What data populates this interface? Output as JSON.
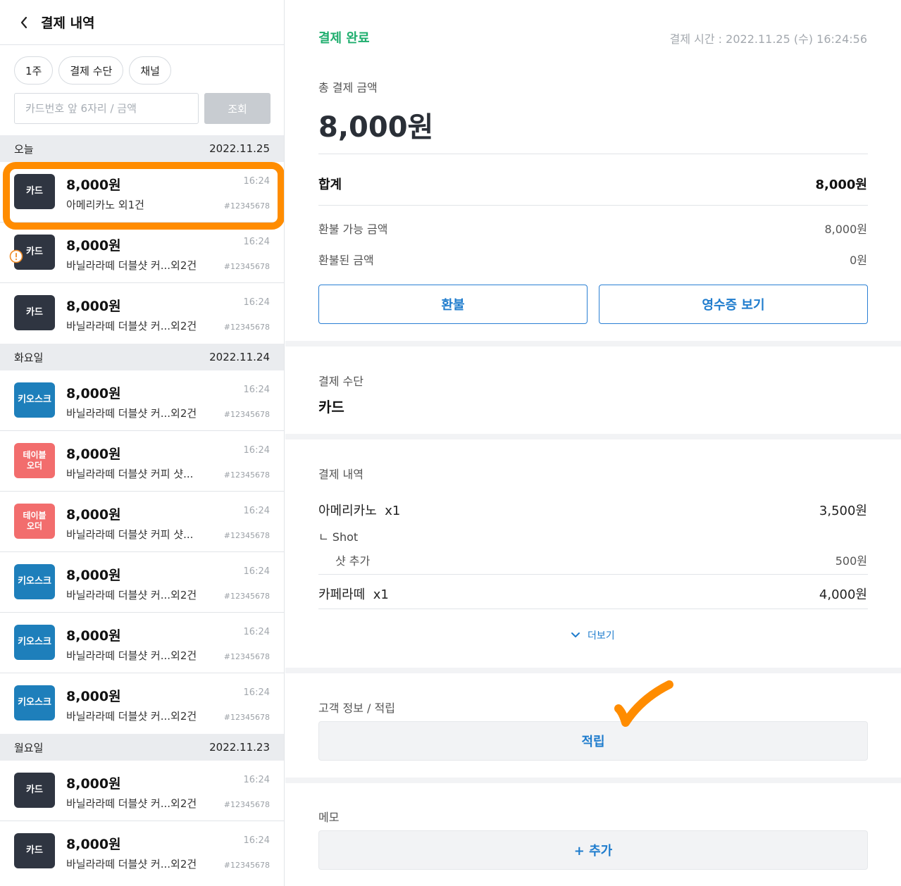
{
  "header": {
    "title": "결제 내역"
  },
  "filters": {
    "chips": [
      "1주",
      "결제 수단",
      "채널"
    ]
  },
  "search": {
    "placeholder": "카드번호 앞 6자리 / 금액",
    "button_label": "조회"
  },
  "colors": {
    "highlight": "#ff8c00",
    "accent_blue": "#1f7ccd",
    "status_green": "#1fae6e",
    "card_badge": "#2f3541",
    "kiosk_badge": "#1e7fbb",
    "table_badge": "#f26d6d"
  },
  "groups": [
    {
      "day": "오늘",
      "date": "2022.11.25",
      "items": [
        {
          "badge": "카드",
          "type": "card",
          "amount": "8,000원",
          "desc": "아메리카노 외1건",
          "time": "16:24",
          "order": "#12345678",
          "selected": true,
          "warning": false
        },
        {
          "badge": "카드",
          "type": "card",
          "amount": "8,000원",
          "desc": "바닐라라떼 더블샷 커...외2건",
          "time": "16:24",
          "order": "#12345678",
          "selected": false,
          "warning": true
        },
        {
          "badge": "카드",
          "type": "card",
          "amount": "8,000원",
          "desc": "바닐라라떼 더블샷 커...외2건",
          "time": "16:24",
          "order": "#12345678",
          "selected": false,
          "warning": false
        }
      ]
    },
    {
      "day": "화요일",
      "date": "2022.11.24",
      "items": [
        {
          "badge": "키오스크",
          "type": "kiosk",
          "amount": "8,000원",
          "desc": "바닐라라떼 더블샷 커...외2건",
          "time": "16:24",
          "order": "#12345678",
          "selected": false,
          "warning": false
        },
        {
          "badge": "테이블\n오더",
          "type": "table",
          "amount": "8,000원",
          "desc": "바닐라라떼 더블샷 커피 샷...",
          "time": "16:24",
          "order": "#12345678",
          "selected": false,
          "warning": false
        },
        {
          "badge": "테이블\n오더",
          "type": "table",
          "amount": "8,000원",
          "desc": "바닐라라떼 더블샷 커피 샷...",
          "time": "16:24",
          "order": "#12345678",
          "selected": false,
          "warning": false
        },
        {
          "badge": "키오스크",
          "type": "kiosk",
          "amount": "8,000원",
          "desc": "바닐라라떼 더블샷 커...외2건",
          "time": "16:24",
          "order": "#12345678",
          "selected": false,
          "warning": false
        },
        {
          "badge": "키오스크",
          "type": "kiosk",
          "amount": "8,000원",
          "desc": "바닐라라떼 더블샷 커...외2건",
          "time": "16:24",
          "order": "#12345678",
          "selected": false,
          "warning": false
        },
        {
          "badge": "키오스크",
          "type": "kiosk",
          "amount": "8,000원",
          "desc": "바닐라라떼 더블샷 커...외2건",
          "time": "16:24",
          "order": "#12345678",
          "selected": false,
          "warning": false
        }
      ]
    },
    {
      "day": "월요일",
      "date": "2022.11.23",
      "items": [
        {
          "badge": "카드",
          "type": "card",
          "amount": "8,000원",
          "desc": "바닐라라떼 더블샷 커...외2건",
          "time": "16:24",
          "order": "#12345678",
          "selected": false,
          "warning": false
        },
        {
          "badge": "카드",
          "type": "card",
          "amount": "8,000원",
          "desc": "바닐라라떼 더블샷 커...외2건",
          "time": "16:24",
          "order": "#12345678",
          "selected": false,
          "warning": false
        }
      ]
    }
  ],
  "detail": {
    "status": "결제 완료",
    "pay_time": "결제 시간 : 2022.11.25 (수) 16:24:56",
    "total_label": "총 결제 금액",
    "total_amount": "8,000원",
    "sum_label": "합계",
    "sum_value": "8,000원",
    "refundable_label": "환불 가능 금액",
    "refundable_value": "8,000원",
    "refunded_label": "환불된 금액",
    "refunded_value": "0원",
    "refund_button": "환불",
    "receipt_button": "영수증 보기",
    "method_label": "결제 수단",
    "method_value": "카드",
    "history_label": "결제 내역",
    "line_items": [
      {
        "name": "아메리카노",
        "qty": "x1",
        "price": "3,500원"
      },
      {
        "name": "카페라떼",
        "qty": "x1",
        "price": "4,000원"
      }
    ],
    "option_group": "ㄴ  Shot",
    "option_name": "샷 추가",
    "option_price": "500원",
    "more_label": "더보기",
    "customer_label": "고객 정보 / 적립",
    "earn_button": "적립",
    "memo_label": "메모",
    "memo_add": "+ 추가"
  }
}
